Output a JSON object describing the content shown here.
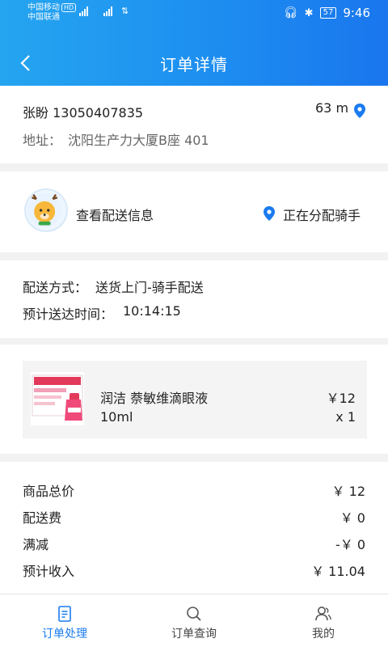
{
  "status_bar": {
    "carrier_primary": "中国移动",
    "hd_badge": "HD",
    "carrier_secondary": "中国联通",
    "battery": "57",
    "time": "9:46"
  },
  "navbar": {
    "title": "订单详情"
  },
  "customer": {
    "name_phone": "张盼 13050407835",
    "distance": "63 m",
    "address_label": "地址：",
    "address": "沈阳生产力大厦B座 401"
  },
  "delivery_info": {
    "view_label": "查看配送信息",
    "status": "正在分配骑手"
  },
  "shipping": {
    "method_label": "配送方式：",
    "method_value": "送货上门-骑手配送",
    "eta_label": "预计送达时间：",
    "eta_value": "10:14:15"
  },
  "product": {
    "name": "润洁 萘敏维滴眼液",
    "spec": "10ml",
    "price": "￥12",
    "quantity": "x 1"
  },
  "summary": [
    {
      "label": "商品总价",
      "value": "￥ 12"
    },
    {
      "label": "配送费",
      "value": "￥ 0"
    },
    {
      "label": "满减",
      "value": "-￥ 0"
    },
    {
      "label": "预计收入",
      "value": "￥ 11.04"
    }
  ],
  "tabs": [
    {
      "label": "订单处理",
      "icon": "order-list-icon",
      "active": true
    },
    {
      "label": "订单查询",
      "icon": "search-icon",
      "active": false
    },
    {
      "label": "我的",
      "icon": "user-icon",
      "active": false
    }
  ],
  "colors": {
    "accent": "#1a7bef",
    "header_start": "#25a5f0",
    "header_end": "#1a76ee"
  }
}
